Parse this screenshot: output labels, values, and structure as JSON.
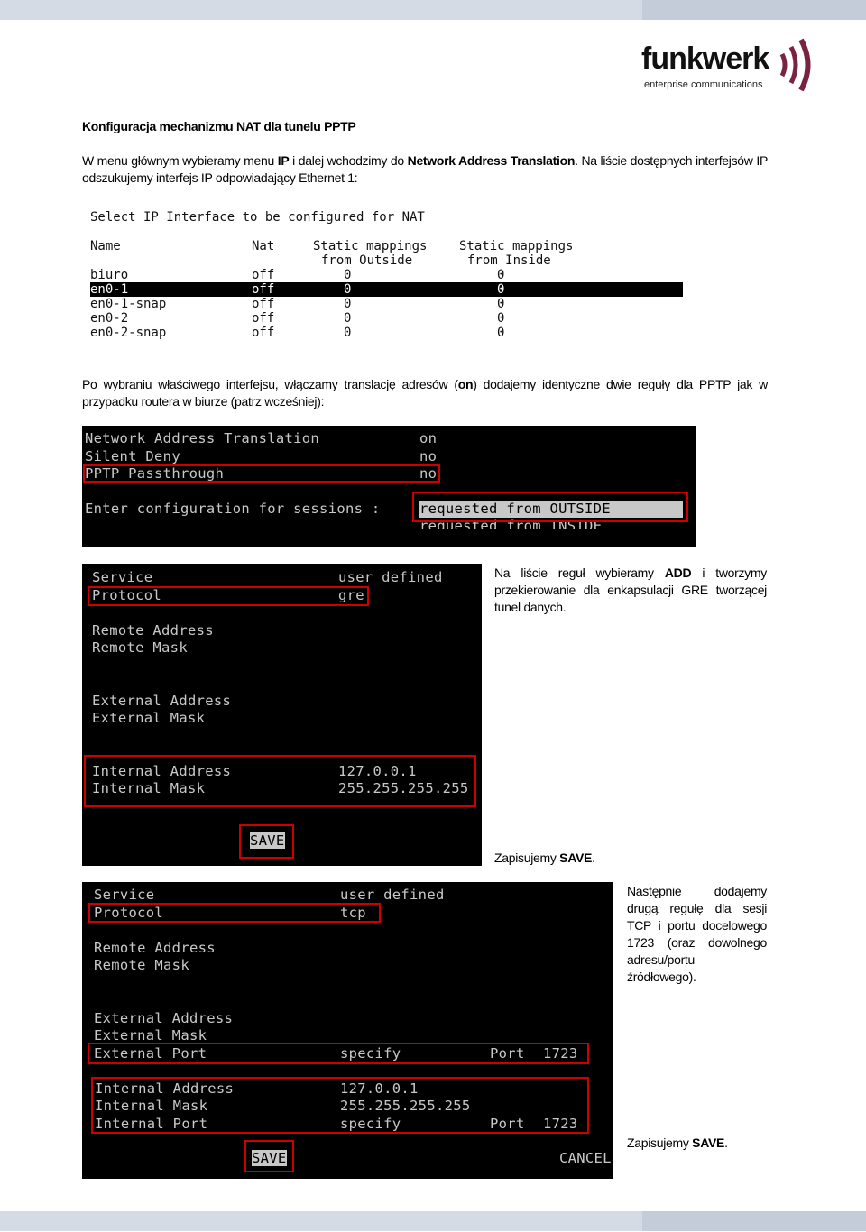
{
  "logo": {
    "name": "funkwerk",
    "tagline": "enterprise communications",
    "color": "#7a2341"
  },
  "heading": "Konfiguracja mechanizmu NAT dla tunelu PPTP",
  "para1": {
    "a": "W menu głównym wybieramy menu ",
    "b": "IP",
    "c": " i dalej wchodzimy do ",
    "d": "Network Address Translation",
    "e": ". Na liście dostępnych interfejsów IP",
    "line2": "odszukujemy interfejs IP odpowiadający Ethernet 1:"
  },
  "nat_table": {
    "title": "Select IP Interface to be configured for NAT",
    "headers": [
      "Name",
      "Nat",
      "Static mappings",
      "Static mappings"
    ],
    "headers2": [
      "from Outside",
      "from Inside"
    ],
    "rows": [
      [
        "biuro",
        "off",
        "0",
        "0"
      ],
      [
        "en0-1",
        "off",
        "0",
        "0"
      ],
      [
        "en0-1-snap",
        "off",
        "0",
        "0"
      ],
      [
        "en0-2",
        "off",
        "0",
        "0"
      ],
      [
        "en0-2-snap",
        "off",
        "0",
        "0"
      ]
    ],
    "selected": "en0-1"
  },
  "para2": {
    "line1a": "Po wybraniu właściwego interfejsu, włączamy translację adresów (",
    "on": "on",
    "line1b": ")  dodajemy identyczne dwie reguły dla PPTP jak w",
    "line2": "przypadku routera w biurze (patrz wcześniej):"
  },
  "term1": {
    "rows": [
      [
        "Network Address Translation",
        "on"
      ],
      [
        "Silent Deny",
        "no"
      ],
      [
        "PPTP Passthrough",
        "no"
      ]
    ],
    "sessions_label": "Enter configuration for sessions :",
    "options": [
      "requested from OUTSIDE",
      "requested from INSIDE"
    ]
  },
  "term2": {
    "service": "Service",
    "service_val": "user defined",
    "protocol": "Protocol",
    "protocol_val": "gre",
    "remote_addr": "Remote Address",
    "remote_mask": "Remote Mask",
    "ext_addr": "External Address",
    "ext_mask": "External Mask",
    "int_addr": "Internal Address",
    "int_addr_val": "127.0.0.1",
    "int_mask": "Internal Mask",
    "int_mask_val": "255.255.255.255",
    "save": "SAVE"
  },
  "side2": {
    "a": "Na liście reguł wybieramy ",
    "b": "ADD",
    "c": " i tworzymy przekierowanie dla enkapsulacji GRE tworzącej tunel danych.",
    "save_a": "Zapisujemy ",
    "save_b": "SAVE",
    "save_c": "."
  },
  "term3": {
    "service": "Service",
    "service_val": "user defined",
    "protocol": "Protocol",
    "protocol_val": "tcp",
    "remote_addr": "Remote Address",
    "remote_mask": "Remote Mask",
    "ext_addr": "External Address",
    "ext_mask": "External Mask",
    "ext_port": "External Port",
    "ext_port_val": "specify",
    "port_label": "Port",
    "ext_port_num": "1723",
    "int_addr": "Internal Address",
    "int_addr_val": "127.0.0.1",
    "int_mask": "Internal Mask",
    "int_mask_val": "255.255.255.255",
    "int_port": "Internal Port",
    "int_port_val": "specify",
    "int_port_num": "1723",
    "save": "SAVE",
    "cancel": "CANCEL"
  },
  "side3": {
    "text": "Następnie dodajemy drugą regułę dla sesji TCP i portu docelowego 1723 (oraz dowolnego adresu/portu źródłowego).",
    "save_a": "Zapisujemy ",
    "save_b": "SAVE",
    "save_c": "."
  }
}
